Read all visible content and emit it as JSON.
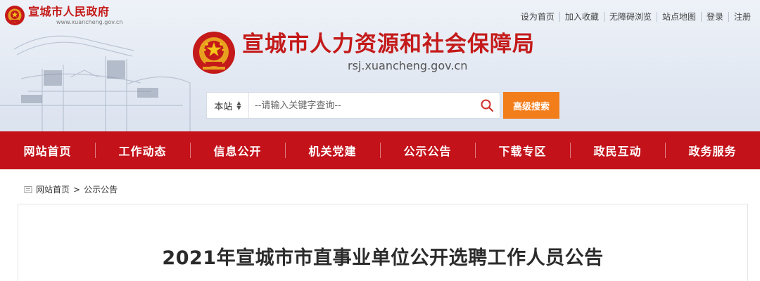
{
  "colors": {
    "brand_red": "#c4121a",
    "title_red": "#c41a1a",
    "accent_orange": "#f27d1b",
    "header_bg": "#e3e9f3"
  },
  "gov": {
    "name": "宣城市人民政府",
    "domain": "www.xuancheng.gov.cn",
    "emblem_icon": "national-emblem-icon"
  },
  "top_links": [
    "设为首页",
    "加入收藏",
    "无障碍浏览",
    "站点地图",
    "登录",
    "注册"
  ],
  "site": {
    "name": "宣城市人力资源和社会保障局",
    "domain": "rsj.xuancheng.gov.cn",
    "emblem_icon": "national-emblem-icon"
  },
  "search": {
    "scope": "本站",
    "placeholder": "--请输入关键字查询--",
    "icon": "search-icon",
    "advanced_label": "高级搜索"
  },
  "nav": [
    "网站首页",
    "工作动态",
    "信息公开",
    "机关党建",
    "公示公告",
    "下载专区",
    "政民互动",
    "政务服务"
  ],
  "breadcrumb": {
    "icon": "home-icon",
    "items": [
      "网站首页",
      "公示公告"
    ],
    "separator": ">"
  },
  "article": {
    "title": "2021年宣城市市直事业单位公开选聘工作人员公告"
  }
}
